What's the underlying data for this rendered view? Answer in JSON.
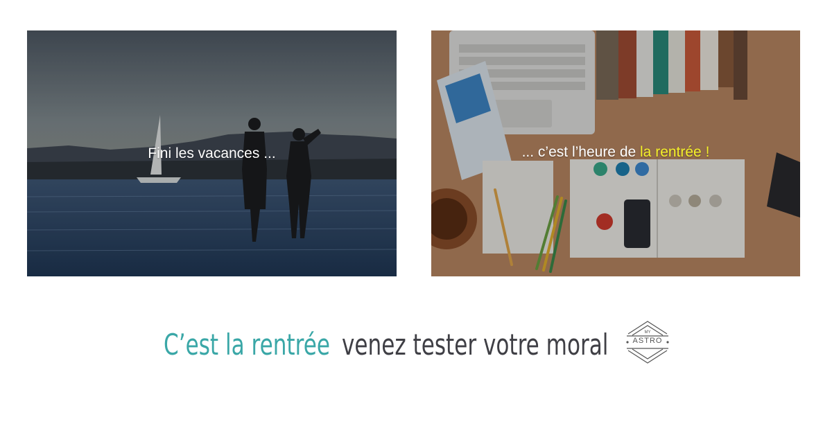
{
  "left_panel": {
    "caption": "Fini les vacances ..."
  },
  "right_panel": {
    "caption_prefix": "... c’est l’heure de ",
    "caption_highlight": "la rentrée !"
  },
  "slogan": {
    "teal_text": "C’est la rentrée",
    "dark_text": "venez tester votre moral"
  },
  "logo": {
    "top_text": "MY",
    "name": "ASTRO"
  },
  "colors": {
    "teal": "#3aa7a7",
    "dark": "#3f3f45",
    "highlight": "#f5f02a"
  }
}
